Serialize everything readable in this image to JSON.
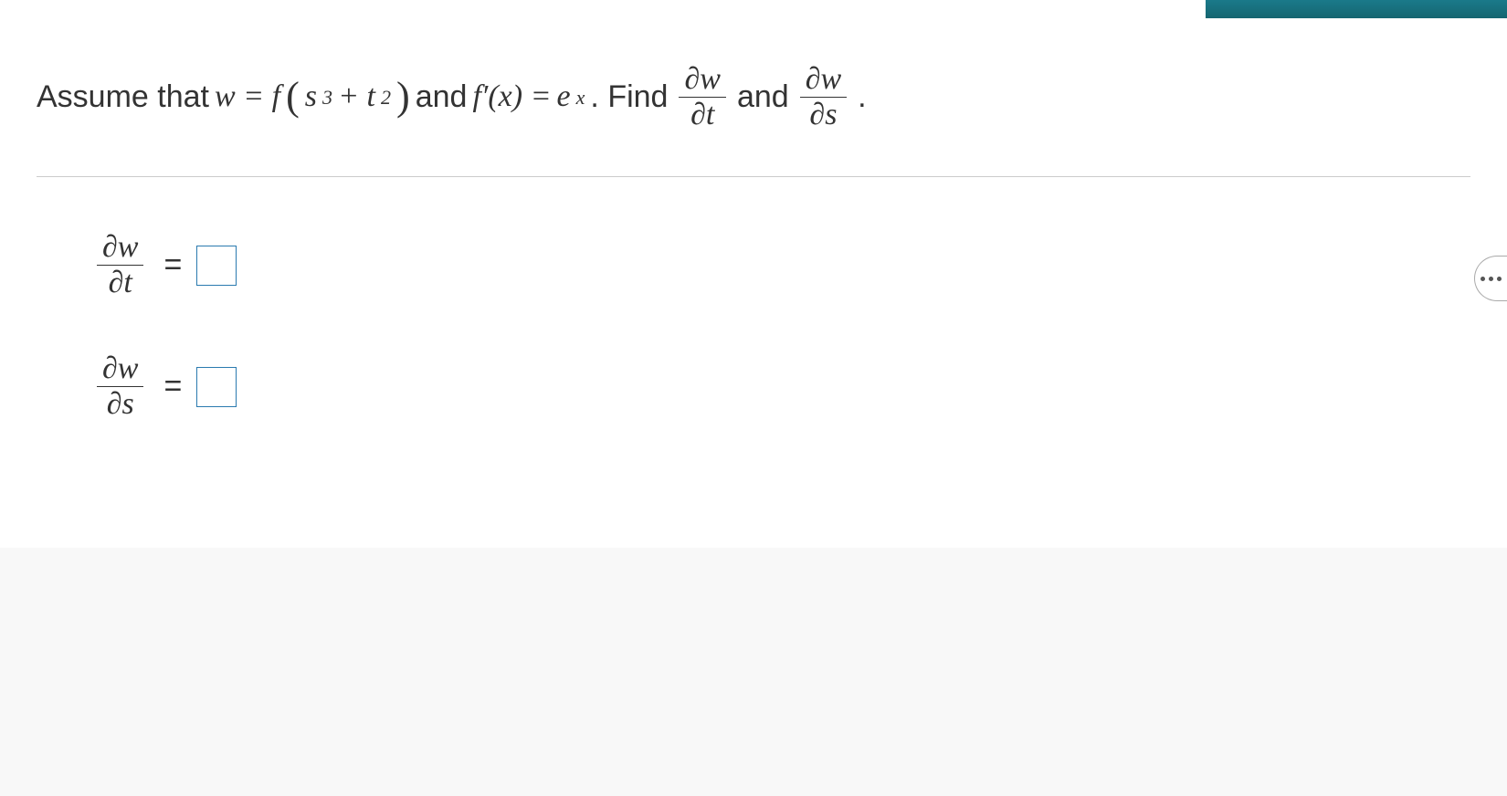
{
  "question": {
    "prefix": "Assume that ",
    "w_eq": "w = f",
    "inner_arg": "s",
    "inner_exp1": "3",
    "plus": " + t",
    "inner_exp2": "2",
    "and_text": " and ",
    "fprime": "f′(x) = ",
    "e_base": "e",
    "e_exp": "x",
    "find": ". Find ",
    "frac1_num": "∂w",
    "frac1_den": "∂t",
    "and2": " and ",
    "frac2_num": "∂w",
    "frac2_den": "∂s",
    "period": "."
  },
  "answers": {
    "row1_num": "∂w",
    "row1_den": "∂t",
    "row2_num": "∂w",
    "row2_den": "∂s",
    "equals": "="
  }
}
